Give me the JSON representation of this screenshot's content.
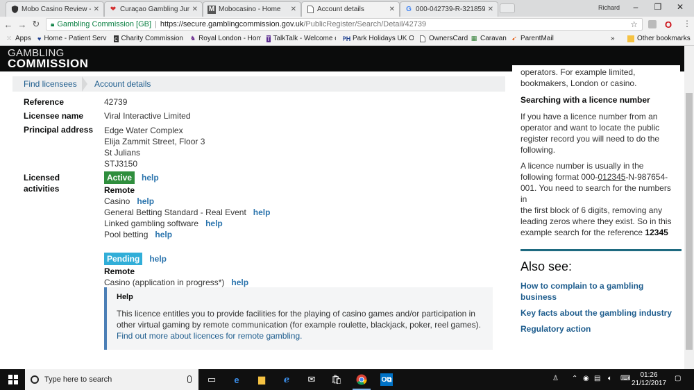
{
  "browser": {
    "tabs": [
      {
        "label": "Mobo Casino Review - Yo",
        "icon": "shield-icon"
      },
      {
        "label": "Curaçao Gambling Jurisdi",
        "icon": "heart-icon"
      },
      {
        "label": "Mobocasino - Home",
        "icon": "m-logo-icon"
      },
      {
        "label": "Account details",
        "icon": "page-icon"
      },
      {
        "label": "000-042739-R-321859-0",
        "icon": "google-icon"
      }
    ],
    "user": "Richard",
    "omnibox": {
      "secure_label": "Gambling Commission [GB]",
      "url_host": "https://secure.gamblingcommission.gov.uk",
      "url_path": "/PublicRegister/Search/Detail/42739"
    },
    "bookmarks": [
      {
        "label": "Apps",
        "icon": "apps-grid-icon"
      },
      {
        "label": "Home - Patient Servi",
        "icon": "heart-icon"
      },
      {
        "label": "Charity Commission",
        "icon": "charity-icon"
      },
      {
        "label": "Royal London - Home",
        "icon": "royal-london-icon"
      },
      {
        "label": "TalkTalk - Welcome c",
        "icon": "talktalk-icon"
      },
      {
        "label": "Park Holidays UK Ow",
        "icon": "park-holidays-icon"
      },
      {
        "label": "OwnersCard",
        "icon": "page-icon"
      },
      {
        "label": "Caravan",
        "icon": "caravan-icon"
      },
      {
        "label": "ParentMail",
        "icon": "parentmail-icon"
      }
    ],
    "bookmarks_more": "»",
    "other_bookmarks": "Other bookmarks"
  },
  "site": {
    "logo_line1": "GAMBLING",
    "logo_line2": "COMMISSION"
  },
  "breadcrumb": {
    "item1": "Find licensees",
    "item2": "Account details"
  },
  "details": {
    "reference_label": "Reference",
    "reference_value": "42739",
    "licensee_label": "Licensee name",
    "licensee_value": "Viral Interactive Limited",
    "address_label": "Principal address",
    "address_lines": [
      "Edge Water Complex",
      "Elija Zammit Street, Floor 3",
      "St Julians",
      "STJ3150"
    ],
    "activities_label_line1": "Licensed",
    "activities_label_line2": "activities",
    "help_text": "help",
    "active_badge": "Active",
    "active_group": "Remote",
    "active_items": [
      "Casino",
      "General Betting Standard - Real Event",
      "Linked gambling software",
      "Pool betting"
    ],
    "pending_badge": "Pending",
    "pending_group": "Remote",
    "pending_items": [
      "Casino (application in progress*)"
    ]
  },
  "helpbox": {
    "title": "Help",
    "body_line1": "This licence entitles you to provide facilities for the playing of casino games and/or participation in",
    "body_line2": "other virtual gaming by remote communication (for example roulette, blackjack, poker, reel games).",
    "link": "Find out more about licences for remote gambling."
  },
  "sidebar": {
    "intro_line1": "operators. For example limited,",
    "intro_line2": "bookmakers, London or casino.",
    "heading": "Searching with a licence number",
    "para1": [
      "If you have a licence number from an",
      "operator and want to locate the public",
      "register record you will need to do the",
      "following."
    ],
    "para2_line1": "A licence number is usually in the",
    "para2_line2_pre": "following format 000-",
    "para2_line2_underline": "012345",
    "para2_line2_post": "-N-987654-",
    "para2_rest": [
      "001. You need to search for the numbers in",
      "the first block of 6 digits, removing any",
      "leading zeros where they exist. So in this"
    ],
    "para2_last_pre": "example search for the reference ",
    "para2_last_bold": "12345",
    "also_see": "Also see:",
    "links": [
      "How to complain to a gambling",
      "business",
      "Key facts about the gambling industry",
      "Regulatory action"
    ]
  },
  "taskbar": {
    "search_placeholder": "Type here to search",
    "time": "01:26",
    "date": "21/12/2017"
  }
}
